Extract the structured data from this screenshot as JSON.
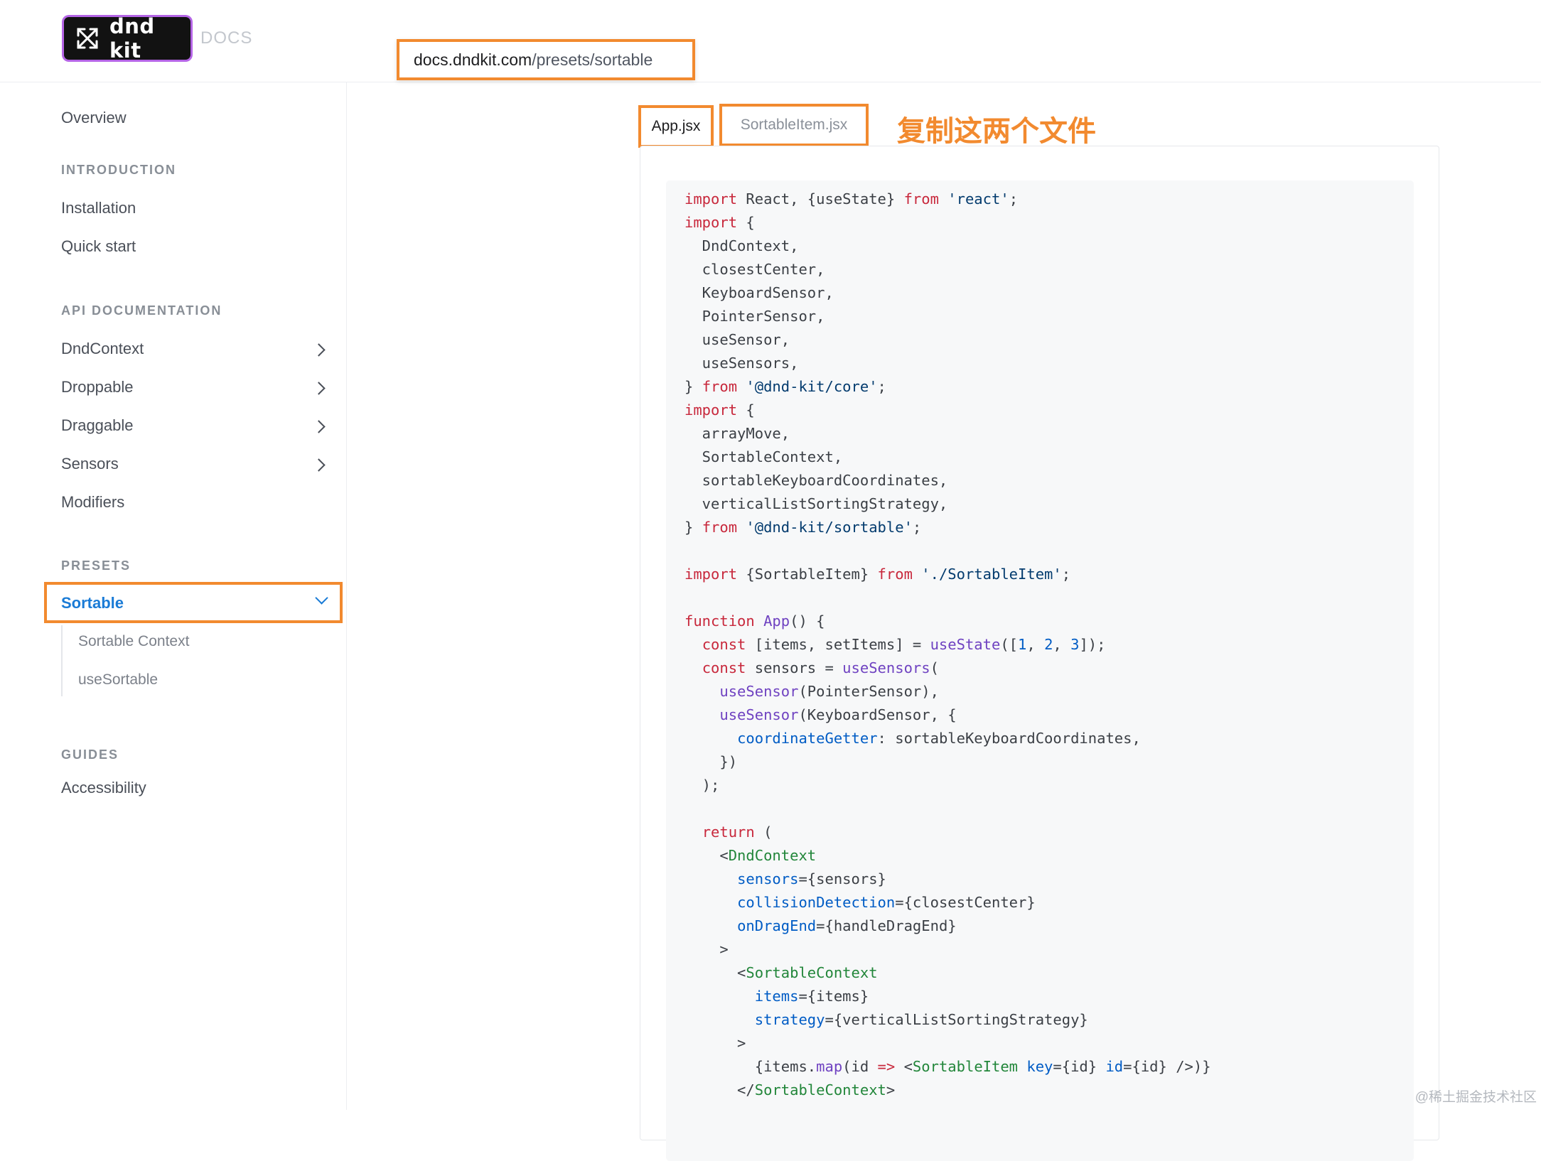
{
  "header": {
    "logo_text": "dnd kit",
    "logo_icon": "arrows-expand-icon",
    "docs_label": "DOCS",
    "url_domain": "docs.dndkit.com",
    "url_path": "/presets/sortable"
  },
  "sidebar": {
    "overview": "Overview",
    "sections": {
      "introduction": "INTRODUCTION",
      "api": "API DOCUMENTATION",
      "presets": "PRESETS",
      "guides": "GUIDES"
    },
    "items": {
      "installation": "Installation",
      "quick_start": "Quick start",
      "dndcontext": "DndContext",
      "droppable": "Droppable",
      "draggable": "Draggable",
      "sensors": "Sensors",
      "modifiers": "Modifiers",
      "sortable": "Sortable",
      "sortable_context": "Sortable Context",
      "use_sortable": "useSortable",
      "accessibility": "Accessibility"
    }
  },
  "tabs": {
    "app": "App.jsx",
    "sortable_item": "SortableItem.jsx"
  },
  "annotation": "复制这两个文件",
  "accent_color": "#f28a2f",
  "code_lines": [
    [
      [
        "k",
        "import"
      ],
      [
        "p",
        " React, {useState} "
      ],
      [
        "k",
        "from"
      ],
      [
        "p",
        " "
      ],
      [
        "s",
        "'react'"
      ],
      [
        "p",
        ";"
      ]
    ],
    [
      [
        "k",
        "import"
      ],
      [
        "p",
        " {"
      ]
    ],
    [
      [
        "p",
        "  DndContext,"
      ]
    ],
    [
      [
        "p",
        "  closestCenter,"
      ]
    ],
    [
      [
        "p",
        "  KeyboardSensor,"
      ]
    ],
    [
      [
        "p",
        "  PointerSensor,"
      ]
    ],
    [
      [
        "p",
        "  useSensor,"
      ]
    ],
    [
      [
        "p",
        "  useSensors,"
      ]
    ],
    [
      [
        "p",
        "} "
      ],
      [
        "k",
        "from"
      ],
      [
        "p",
        " "
      ],
      [
        "s",
        "'@dnd-kit/core'"
      ],
      [
        "p",
        ";"
      ]
    ],
    [
      [
        "k",
        "import"
      ],
      [
        "p",
        " {"
      ]
    ],
    [
      [
        "p",
        "  arrayMove,"
      ]
    ],
    [
      [
        "p",
        "  SortableContext,"
      ]
    ],
    [
      [
        "p",
        "  sortableKeyboardCoordinates,"
      ]
    ],
    [
      [
        "p",
        "  verticalListSortingStrategy,"
      ]
    ],
    [
      [
        "p",
        "} "
      ],
      [
        "k",
        "from"
      ],
      [
        "p",
        " "
      ],
      [
        "s",
        "'@dnd-kit/sortable'"
      ],
      [
        "p",
        ";"
      ]
    ],
    [],
    [
      [
        "k",
        "import"
      ],
      [
        "p",
        " {SortableItem} "
      ],
      [
        "k",
        "from"
      ],
      [
        "p",
        " "
      ],
      [
        "s",
        "'./SortableItem'"
      ],
      [
        "p",
        ";"
      ]
    ],
    [],
    [
      [
        "k",
        "function"
      ],
      [
        "p",
        " "
      ],
      [
        "f",
        "App"
      ],
      [
        "p",
        "() {"
      ]
    ],
    [
      [
        "p",
        "  "
      ],
      [
        "k",
        "const"
      ],
      [
        "p",
        " [items, setItems] = "
      ],
      [
        "f",
        "useState"
      ],
      [
        "p",
        "(["
      ],
      [
        "n",
        "1"
      ],
      [
        "p",
        ", "
      ],
      [
        "n",
        "2"
      ],
      [
        "p",
        ", "
      ],
      [
        "n",
        "3"
      ],
      [
        "p",
        "]);"
      ]
    ],
    [
      [
        "p",
        "  "
      ],
      [
        "k",
        "const"
      ],
      [
        "p",
        " sensors = "
      ],
      [
        "f",
        "useSensors"
      ],
      [
        "p",
        "("
      ]
    ],
    [
      [
        "p",
        "    "
      ],
      [
        "f",
        "useSensor"
      ],
      [
        "p",
        "(PointerSensor),"
      ]
    ],
    [
      [
        "p",
        "    "
      ],
      [
        "f",
        "useSensor"
      ],
      [
        "p",
        "(KeyboardSensor, {"
      ]
    ],
    [
      [
        "p",
        "      "
      ],
      [
        "a",
        "coordinateGetter"
      ],
      [
        "p",
        ": sortableKeyboardCoordinates,"
      ]
    ],
    [
      [
        "p",
        "    })"
      ]
    ],
    [
      [
        "p",
        "  );"
      ]
    ],
    [],
    [
      [
        "p",
        "  "
      ],
      [
        "k",
        "return"
      ],
      [
        "p",
        " ("
      ]
    ],
    [
      [
        "p",
        "    <"
      ],
      [
        "t",
        "DndContext"
      ]
    ],
    [
      [
        "p",
        "      "
      ],
      [
        "a",
        "sensors"
      ],
      [
        "p",
        "={sensors}"
      ]
    ],
    [
      [
        "p",
        "      "
      ],
      [
        "a",
        "collisionDetection"
      ],
      [
        "p",
        "={closestCenter}"
      ]
    ],
    [
      [
        "p",
        "      "
      ],
      [
        "a",
        "onDragEnd"
      ],
      [
        "p",
        "={handleDragEnd}"
      ]
    ],
    [
      [
        "p",
        "    >"
      ]
    ],
    [
      [
        "p",
        "      <"
      ],
      [
        "t",
        "SortableContext"
      ]
    ],
    [
      [
        "p",
        "        "
      ],
      [
        "a",
        "items"
      ],
      [
        "p",
        "={items}"
      ]
    ],
    [
      [
        "p",
        "        "
      ],
      [
        "a",
        "strategy"
      ],
      [
        "p",
        "={verticalListSortingStrategy}"
      ]
    ],
    [
      [
        "p",
        "      >"
      ]
    ],
    [
      [
        "p",
        "        {items."
      ],
      [
        "f",
        "map"
      ],
      [
        "p",
        "(id "
      ],
      [
        "k",
        "=>"
      ],
      [
        "p",
        " <"
      ],
      [
        "t",
        "SortableItem"
      ],
      [
        "p",
        " "
      ],
      [
        "a",
        "key"
      ],
      [
        "p",
        "={id} "
      ],
      [
        "a",
        "id"
      ],
      [
        "p",
        "={id} />)}"
      ]
    ],
    [
      [
        "p",
        "      </"
      ],
      [
        "t",
        "SortableContext"
      ],
      [
        "p",
        ">"
      ]
    ]
  ],
  "watermark": "@稀土掘金技术社区"
}
